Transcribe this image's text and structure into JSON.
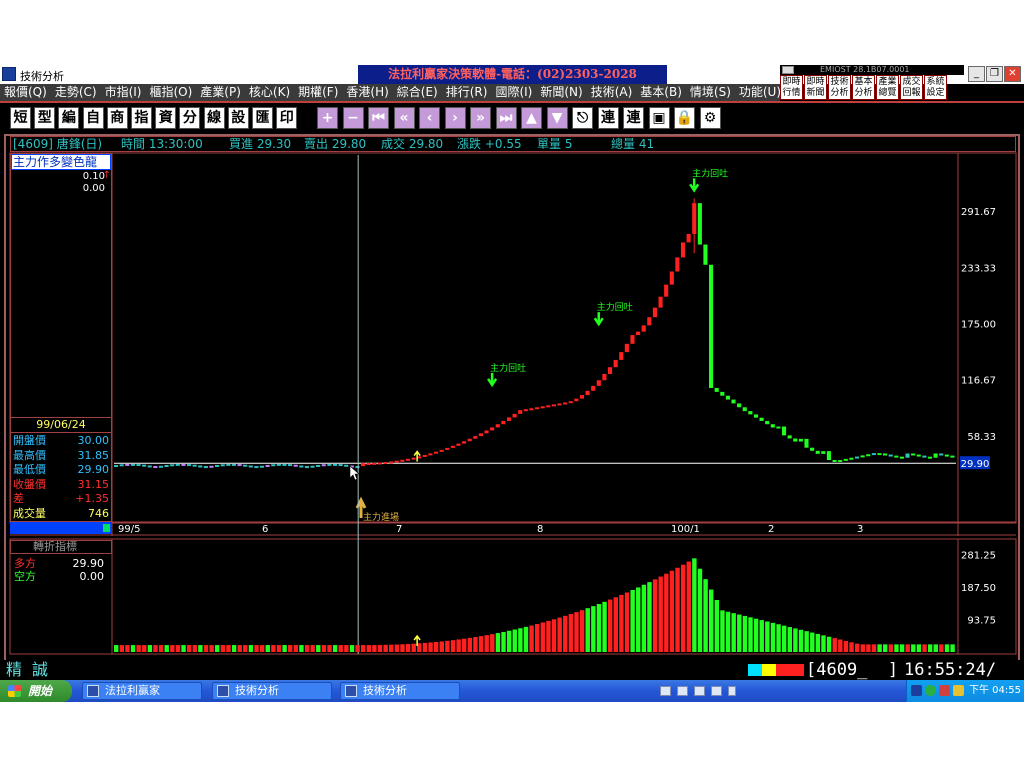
{
  "window": {
    "title": "技術分析",
    "banner": "法拉利贏家決策軟體-電話：(02)2303-2028",
    "emiost_label": "EMIOST 28.1B07.0001",
    "controls": {
      "minimize": "_",
      "restore": "❐",
      "close": "✕"
    }
  },
  "quick_buttons": [
    "即時\n行情",
    "即時\n新聞",
    "技術\n分析",
    "基本\n分析",
    "產業\n總覽",
    "成交\n回報",
    "系統\n設定"
  ],
  "menu": [
    "報價(Q)",
    "走勢(C)",
    "市指(I)",
    "櫃指(O)",
    "產業(P)",
    "核心(K)",
    "期權(F)",
    "香港(H)",
    "綜合(E)",
    "排行(R)",
    "國際(I)",
    "新聞(N)",
    "技術(A)",
    "基本(B)",
    "情境(S)",
    "功能(U)"
  ],
  "toolbar": {
    "char_buttons": [
      "短",
      "型",
      "編",
      "自",
      "商",
      "指",
      "資",
      "分",
      "線",
      "設",
      "匯",
      "印"
    ],
    "icon_buttons": [
      "zoom-in",
      "zoom-out",
      "first",
      "page-left",
      "prev",
      "next",
      "page-right",
      "last",
      "up",
      "down",
      "esc",
      "link",
      "link-2",
      "screenshot",
      "lock",
      "settings"
    ]
  },
  "info": {
    "stock": "[4609] 唐鋒(日)",
    "time": "時間 13:30:00",
    "bid": "買進 29.30",
    "ask": "賣出 29.80",
    "deal": "成交 29.80",
    "change": "漲跌 +0.55",
    "unit_vol": "單量 5",
    "total_vol": "總量 41"
  },
  "left_panel": {
    "title": "主力作多變色龍",
    "val1": "0.10",
    "val2": "0.00",
    "date": "99/06/24",
    "quotes": [
      {
        "label": "開盤價",
        "value": "30.00",
        "color": "#30c0ff"
      },
      {
        "label": "最高價",
        "value": "31.85",
        "color": "#30c0ff"
      },
      {
        "label": "最低價",
        "value": "29.90",
        "color": "#30c0ff"
      },
      {
        "label": "收盤價",
        "value": "31.15",
        "color": "#ff3030"
      },
      {
        "label": "差",
        "value": "+1.35",
        "color": "#ff3030"
      },
      {
        "label": "成交量",
        "value": "746",
        "color": "#ffff60"
      }
    ]
  },
  "indicator": {
    "title": "轉折指標",
    "rows": [
      {
        "label": "多方",
        "value": "29.90",
        "color": "#ff3030"
      },
      {
        "label": "空方",
        "value": "0.00",
        "color": "#30ff30"
      }
    ]
  },
  "chart_data": {
    "type": "candlestick",
    "price_axis_ticks": [
      291.67,
      233.33,
      175.0,
      116.67,
      58.33
    ],
    "current_price": "29.90",
    "x_labels": [
      "99/5",
      "6",
      "7",
      "8",
      "100/1",
      "2",
      "3"
    ],
    "annotations": [
      "主力回吐",
      "主力回吐",
      "主力回吐",
      "主力進場"
    ],
    "volume_axis_ticks": [
      281.25,
      187.5,
      93.75
    ],
    "colors": {
      "up": "#ff2020",
      "down": "#20ff20",
      "flat": "#30c0c0"
    }
  },
  "status": {
    "precise": "精誠",
    "stock_code": "[4609_  ]",
    "clock": "16:55:24/",
    "colorbar": [
      "#00e0ff",
      "#ffff00",
      "#ff2020",
      "#ff2020"
    ]
  },
  "taskbar": {
    "start": "開始",
    "tasks": [
      "法拉利贏家",
      "技術分析",
      "技術分析"
    ],
    "time": "下午 04:55"
  }
}
